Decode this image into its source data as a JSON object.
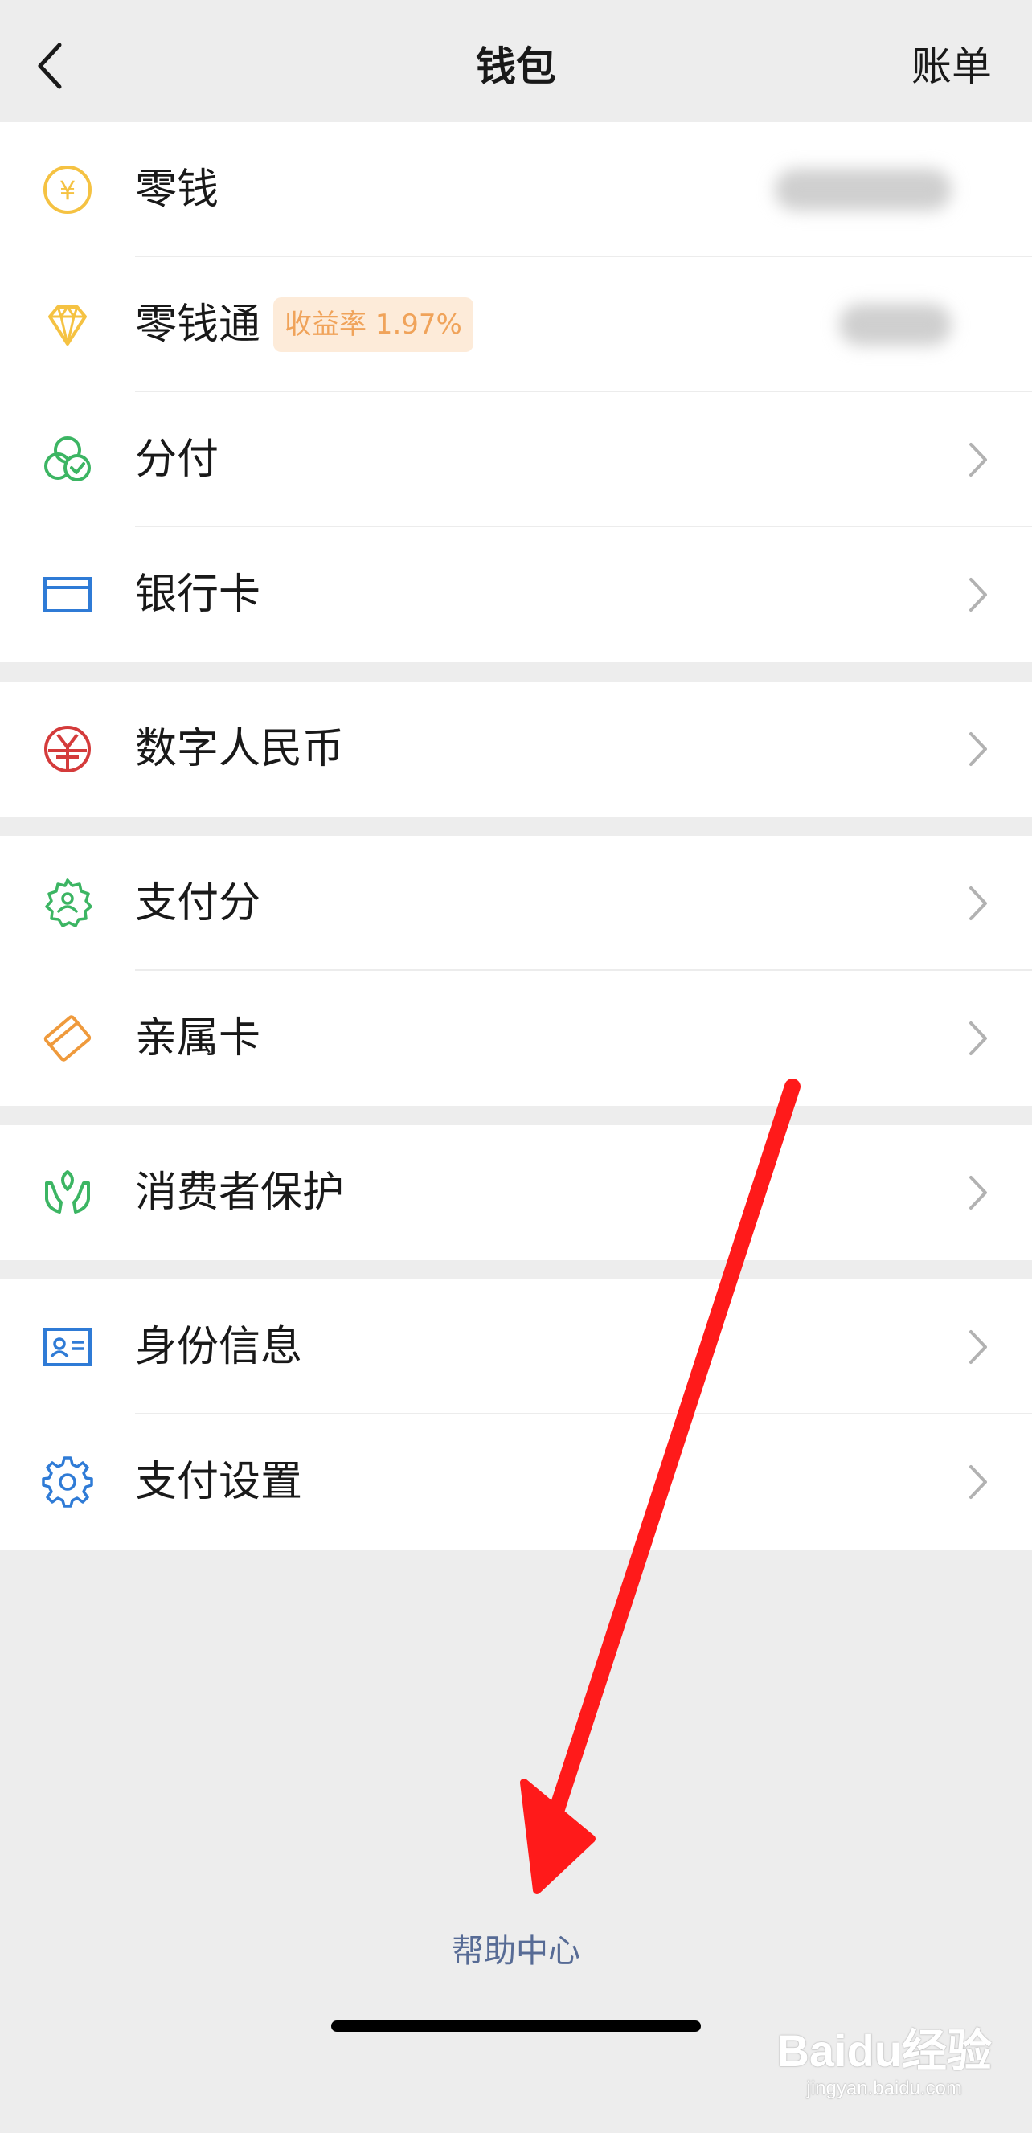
{
  "navbar": {
    "title": "钱包",
    "right_action": "账单",
    "back_icon": "chevron-left-icon"
  },
  "groups": [
    {
      "items": [
        {
          "label": "零钱",
          "icon": "yuan-coin-icon",
          "value": "blurred",
          "color": "#f5c242"
        },
        {
          "label": "零钱通",
          "icon": "diamond-icon",
          "badge": "收益率 1.97%",
          "value": "blurred",
          "color": "#f5c242"
        },
        {
          "label": "分付",
          "icon": "fenfu-icon",
          "color": "#3cb563"
        },
        {
          "label": "银行卡",
          "icon": "bank-card-icon",
          "color": "#2f7bd6"
        }
      ]
    },
    {
      "items": [
        {
          "label": "数字人民币",
          "icon": "digital-rmb-icon",
          "color": "#d43b3b"
        }
      ]
    },
    {
      "items": [
        {
          "label": "支付分",
          "icon": "pay-score-icon",
          "color": "#3cb563"
        },
        {
          "label": "亲属卡",
          "icon": "family-card-icon",
          "color": "#ef9a3c"
        }
      ]
    },
    {
      "items": [
        {
          "label": "消费者保护",
          "icon": "consumer-protection-icon",
          "color": "#3cb563"
        }
      ]
    },
    {
      "items": [
        {
          "label": "身份信息",
          "icon": "id-card-icon",
          "color": "#2f7bd6"
        },
        {
          "label": "支付设置",
          "icon": "gear-icon",
          "color": "#2f7bd6"
        }
      ]
    }
  ],
  "footer": {
    "help_link": "帮助中心"
  },
  "watermark": {
    "logo": "Baidu经验",
    "url": "jingyan.baidu.com"
  },
  "annotation": {
    "arrow_color": "#ff1a1a"
  }
}
